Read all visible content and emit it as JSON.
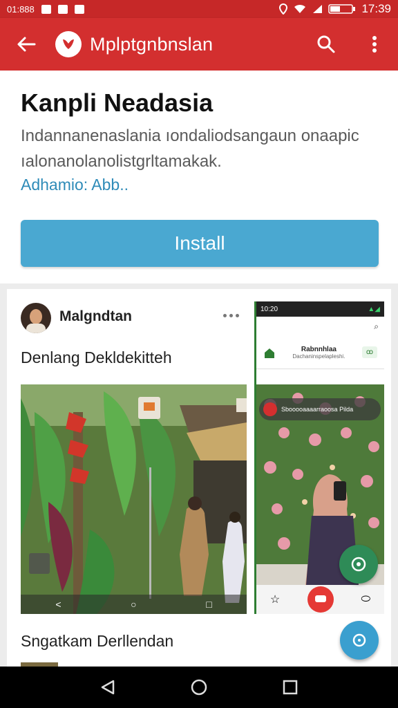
{
  "status_bar": {
    "left_text": "01:888",
    "time": "17:39",
    "icons": [
      "photo-icon",
      "notification-icon",
      "mail-icon",
      "location-icon",
      "wifi-icon",
      "signal-icon",
      "battery-icon"
    ]
  },
  "app_bar": {
    "title": "Mplptgnbnslan",
    "icons": [
      "back-arrow-icon",
      "app-logo-icon",
      "search-icon",
      "more-vert-icon"
    ]
  },
  "app_info": {
    "title": "Kanpli Neadasia",
    "description": "Indannanenaslania ıondaliodsangaun onaapic ıalonanolanolistgrltamakak.",
    "author": "Adhamio: Abb..",
    "install_label": "Install"
  },
  "post": {
    "user_name": "Malgndtan",
    "caption": "Denlang Dekldekitteh",
    "bottom_caption": "Sngatkam  Derllendan",
    "photo_nav": [
      "<",
      "○",
      "□"
    ]
  },
  "phone_screenshot": {
    "status_left": "10:20",
    "row_title": "Rabnnhlaa",
    "row_sub": "Dachaninspelapleshi.",
    "chip": "ꝏ",
    "banner_text": "Sbooooaaaarraoosa Pilda"
  },
  "colors": {
    "app_bar": "#d32f2f",
    "status_bar": "#c62828",
    "install_button": "#4aa8d1",
    "author_link": "#2e8bb8",
    "fab_blue": "#3a9fcf",
    "fab_green": "#2e8b57"
  },
  "nav_bar": {
    "icons": [
      "nav-back-icon",
      "nav-home-icon",
      "nav-recents-icon"
    ]
  }
}
